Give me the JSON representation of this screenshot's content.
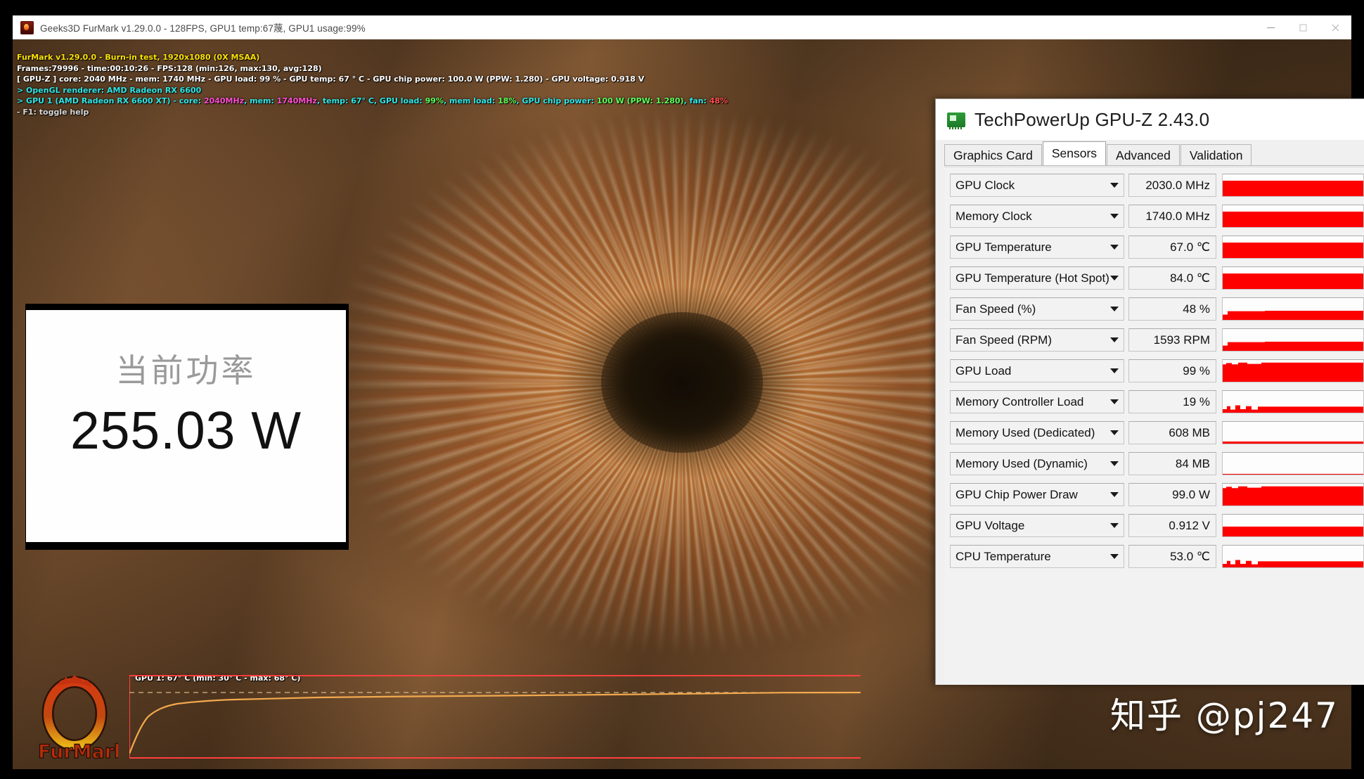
{
  "furmark_window": {
    "titlebar": {
      "icon": "furmark-app-icon",
      "title": "Geeks3D FurMark v1.29.0.0 - 128FPS, GPU1 temp:67蔑, GPU1 usage:99%",
      "minimize_label": "–",
      "maximize_label": "□",
      "close_label": "✕"
    },
    "osd": {
      "line1": "FurMark v1.29.0.0 - Burn-in test, 1920x1080 (0X MSAA)",
      "line2": "Frames:79996 - time:00:10:26 - FPS:128 (min:126, max:130, avg:128)",
      "line3": "[ GPU-Z ] core: 2040 MHz - mem: 1740 MHz - GPU load: 99 % - GPU temp: 67 ° C - GPU chip power: 100.0 W (PPW: 1.280) - GPU voltage: 0.918 V",
      "line4": "> OpenGL renderer: AMD Radeon RX 6600",
      "line5_a": "> GPU 1 (AMD Radeon RX 6600 XT) - core: ",
      "line5_b": "2040MHz",
      "line5_c": ", mem: ",
      "line5_d": "1740MHz",
      "line5_e": ", temp: ",
      "line5_f": "67° C",
      "line5_g": ", GPU load: ",
      "line5_h": "99%",
      "line5_i": ", mem load: ",
      "line5_j": "18%",
      "line5_k": ", GPU chip power: ",
      "line5_l": "100 W (PPW: 1.280)",
      "line5_m": ", fan: ",
      "line5_n": "48%",
      "line6": "- F1: toggle help"
    },
    "graph": {
      "label": "GPU 1: 67° C (min: 30° C - max: 68° C)"
    },
    "logo_alt": "FurMark"
  },
  "power_overlay": {
    "label": "当前功率",
    "value": "255.03 W"
  },
  "gpuz_window": {
    "icon": "gpuz-graphics-card-icon",
    "title": "TechPowerUp GPU-Z 2.43.0",
    "tabs": [
      {
        "label": "Graphics Card",
        "active": false
      },
      {
        "label": "Sensors",
        "active": true
      },
      {
        "label": "Advanced",
        "active": false
      },
      {
        "label": "Validation",
        "active": false
      }
    ],
    "sensors": [
      {
        "name": "GPU Clock",
        "value": "2030.0 MHz",
        "fill_pct": 72,
        "style": "flat"
      },
      {
        "name": "Memory Clock",
        "value": "1740.0 MHz",
        "fill_pct": 72,
        "style": "flat"
      },
      {
        "name": "GPU Temperature",
        "value": "67.0 ℃",
        "fill_pct": 70,
        "style": "flat"
      },
      {
        "name": "GPU Temperature (Hot Spot)",
        "value": "84.0 ℃",
        "fill_pct": 70,
        "style": "flat"
      },
      {
        "name": "Fan Speed (%)",
        "value": "48 %",
        "fill_pct": 42,
        "style": "step"
      },
      {
        "name": "Fan Speed (RPM)",
        "value": "1593 RPM",
        "fill_pct": 42,
        "style": "step"
      },
      {
        "name": "GPU Load",
        "value": "99 %",
        "fill_pct": 82,
        "style": "spiky"
      },
      {
        "name": "Memory Controller Load",
        "value": "19 %",
        "fill_pct": 12,
        "style": "noisy"
      },
      {
        "name": "Memory Used (Dedicated)",
        "value": "608 MB",
        "fill_pct": 10,
        "style": "flat"
      },
      {
        "name": "Memory Used (Dynamic)",
        "value": "84 MB",
        "fill_pct": 4,
        "style": "flat"
      },
      {
        "name": "GPU Chip Power Draw",
        "value": "99.0 W",
        "fill_pct": 66,
        "style": "spiky"
      },
      {
        "name": "GPU Voltage",
        "value": "0.912 V",
        "fill_pct": 46,
        "style": "flat"
      },
      {
        "name": "CPU Temperature",
        "value": "53.0 ℃",
        "fill_pct": 22,
        "style": "noisy"
      }
    ]
  },
  "watermark": {
    "text": "知乎 @pj247"
  },
  "colors": {
    "graph_red": "#fe0000",
    "osd_yellow": "#ffe300",
    "osd_cyan": "#2ee6e6",
    "accent_green": "#2e9c39"
  }
}
